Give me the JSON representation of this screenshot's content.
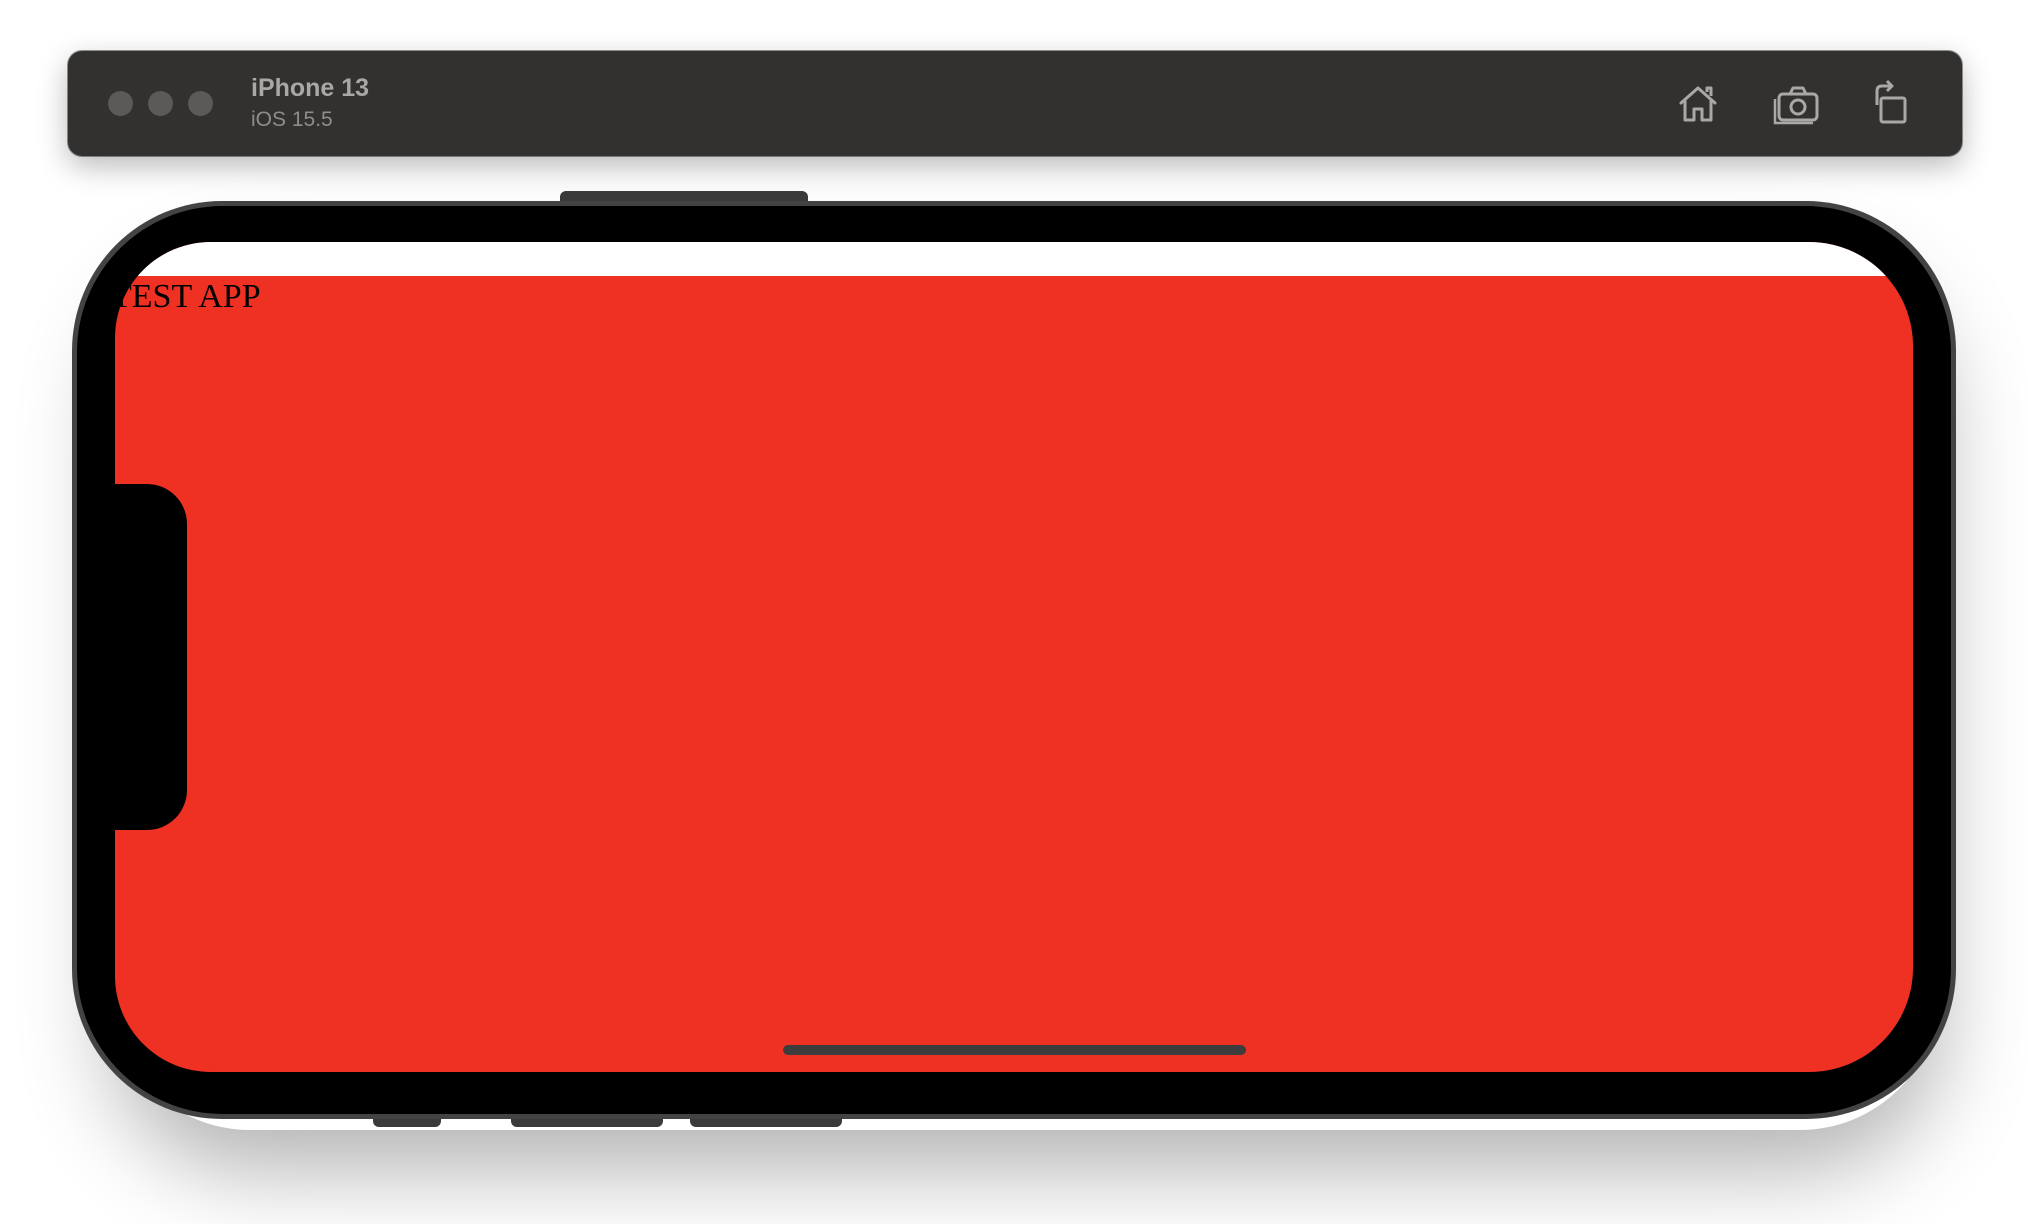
{
  "window": {
    "device_name": "iPhone 13",
    "os_version": "iOS 15.5",
    "traffic_lights": [
      "close",
      "minimize",
      "zoom"
    ],
    "toolbar_icons": [
      "home-icon",
      "screenshot-icon",
      "rotate-icon"
    ]
  },
  "app": {
    "title": "TEST APP",
    "background_color": "#ee3123",
    "status_bar_color": "#ffffff"
  }
}
